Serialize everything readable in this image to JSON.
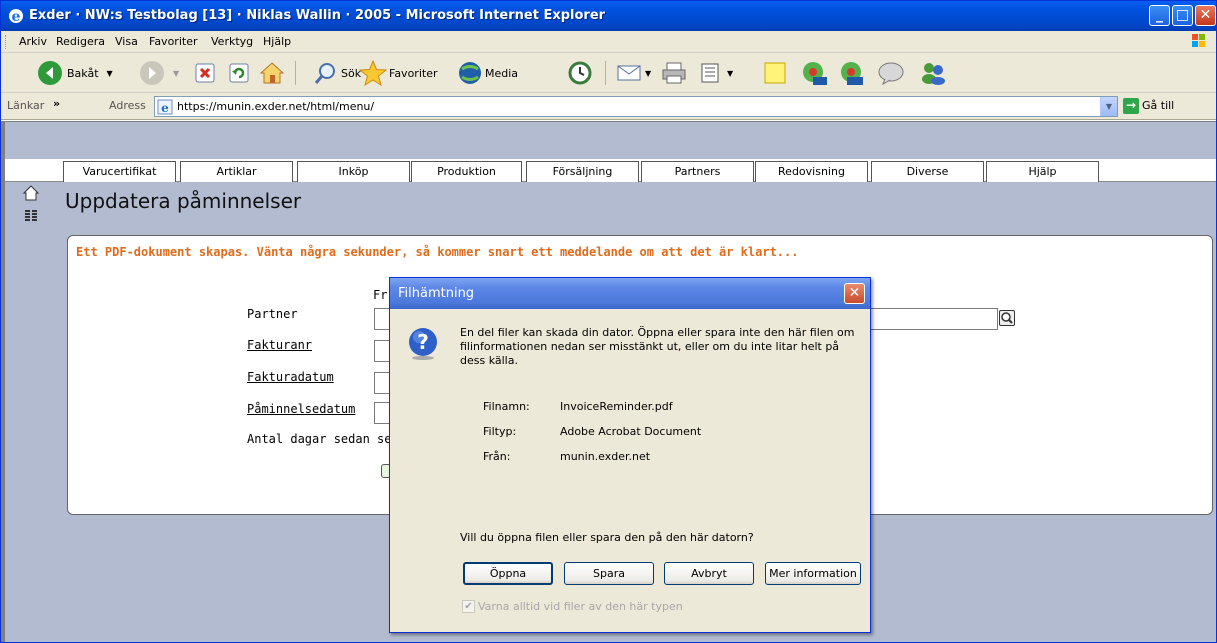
{
  "window": {
    "title": "Exder · NW:s Testbolag [13] · Niklas Wallin · 2005 - Microsoft Internet Explorer"
  },
  "menubar": {
    "items": [
      "Arkiv",
      "Redigera",
      "Visa",
      "Favoriter",
      "Verktyg",
      "Hjälp"
    ]
  },
  "toolbar": {
    "back_label": "Bakåt",
    "search_label": "Sök",
    "favorites_label": "Favoriter",
    "media_label": "Media"
  },
  "addressbar": {
    "links_label": "Länkar",
    "chevron": "»",
    "address_label": "Adress",
    "url": "https://munin.exder.net/html/menu/",
    "go_label": "Gå till"
  },
  "nav": {
    "tabs": [
      "Varucertifikat",
      "Artiklar",
      "Inköp",
      "Produktion",
      "Försäljning",
      "Partners",
      "Redovisning",
      "Diverse",
      "Hjälp"
    ]
  },
  "page": {
    "title": "Uppdatera påminnelser"
  },
  "form": {
    "notice": "Ett PDF-dokument skapas. Vänta några sekunder, så kommer snart ett meddelande om att det är klart...",
    "partial_label": "Fr",
    "labels": [
      "Partner",
      "Fakturanr",
      "Fakturadatum",
      "Påminnelsedatum",
      "Antal dagar sedan se"
    ]
  },
  "dialog": {
    "title": "Filhämtning",
    "warning": "En del filer kan skada din dator. Öppna eller spara inte den här filen om filinformationen nedan ser misstänkt ut, eller om du inte litar helt på dess källa.",
    "fields": [
      {
        "label": "Filnamn:",
        "value": "InvoiceReminder.pdf"
      },
      {
        "label": "Filtyp:",
        "value": "Adobe Acrobat Document"
      },
      {
        "label": "Från:",
        "value": "munin.exder.net"
      }
    ],
    "question": "Vill du öppna filen eller spara den på den här datorn?",
    "buttons": {
      "open": "Öppna",
      "save": "Spara",
      "cancel": "Avbryt",
      "more": "Mer information"
    },
    "checkbox_label": "Varna alltid vid filer av den här typen",
    "checkbox_checked": true
  }
}
